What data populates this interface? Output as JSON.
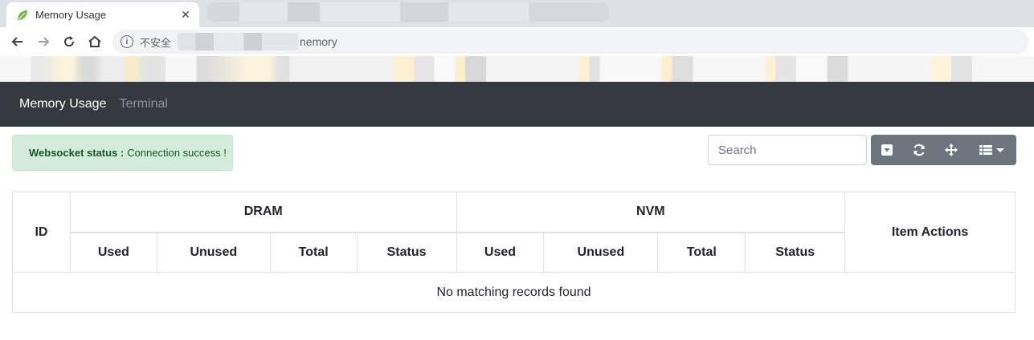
{
  "browser": {
    "tab_title": "Memory Usage",
    "tab_close": "✕",
    "insecure_label": "不安全",
    "url_visible_tail": "nemory"
  },
  "navbar": {
    "brand": "Memory Usage",
    "links": [
      "Terminal"
    ]
  },
  "alert": {
    "label": "Websocket status :",
    "message": "Connection success !",
    "color": "#d4edda"
  },
  "search": {
    "placeholder": "Search",
    "value": ""
  },
  "toolbar": {
    "buttons": [
      "collapse-icon",
      "refresh-icon",
      "move-icon",
      "columns-icon"
    ]
  },
  "table": {
    "id_header": "ID",
    "groups": [
      "DRAM",
      "NVM"
    ],
    "sub_headers": [
      "Used",
      "Unused",
      "Total",
      "Status",
      "Used",
      "Unused",
      "Total",
      "Status"
    ],
    "actions_header": "Item Actions",
    "empty_message": "No matching records found"
  },
  "colors": {
    "navbar_bg": "#343a40",
    "button_bg": "#6c757d",
    "alert_text": "#155724"
  }
}
